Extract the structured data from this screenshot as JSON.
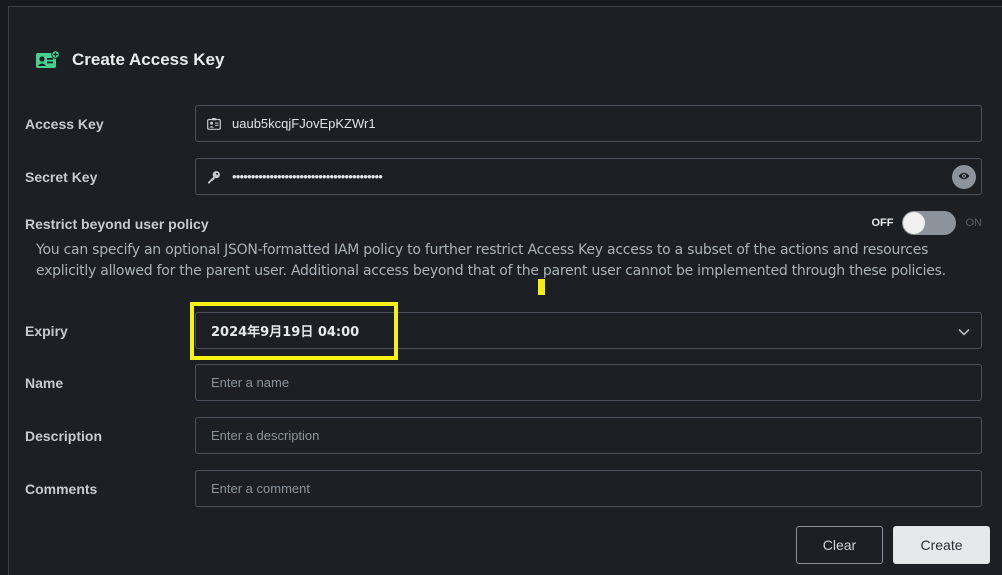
{
  "header": {
    "title": "Create Access Key",
    "icon": "id-card-icon",
    "accent_color": "#47d08e"
  },
  "access_key": {
    "label": "Access Key",
    "value": "uaub5kcqjFJovEpKZWr1",
    "icon": "id-badge-icon"
  },
  "secret_key": {
    "label": "Secret Key",
    "value": "••••••••••••••••••••••••••••••••••••••••",
    "icon": "key-icon",
    "toggle_icon": "eye-icon"
  },
  "restrict": {
    "label": "Restrict beyond user policy",
    "off_label": "OFF",
    "on_label": "ON",
    "state": "off",
    "description": "You can specify an optional JSON-formatted IAM policy to further restrict Access Key access to a subset of the actions and resources explicitly allowed for the parent user. Additional access beyond that of the parent user cannot be implemented through these policies."
  },
  "expiry": {
    "label": "Expiry",
    "value": "2024年9月19日 04:00"
  },
  "name": {
    "label": "Name",
    "placeholder": "Enter a name"
  },
  "description_field": {
    "label": "Description",
    "placeholder": "Enter a description"
  },
  "comments": {
    "label": "Comments",
    "placeholder": "Enter a comment"
  },
  "buttons": {
    "clear": "Clear",
    "create": "Create"
  },
  "annotation": {
    "highlight_color": "#f7f315"
  }
}
